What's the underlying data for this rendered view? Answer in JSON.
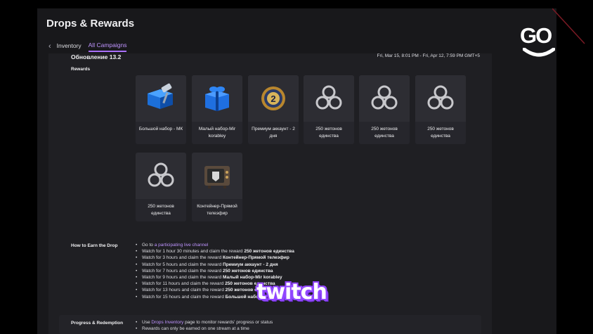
{
  "window": {
    "title": "Drops & Rewards"
  },
  "tabs": [
    {
      "label": "Inventory",
      "active": false
    },
    {
      "label": "All Campaigns",
      "active": true
    }
  ],
  "campaign": {
    "name": "Обновление 13.2",
    "dates": "Fri, Mar 15, 8:01 PM - Fri, Apr 12, 7:59 PM GMT+5"
  },
  "rewards_label": "Rewards",
  "rewards": [
    {
      "name": "Большой набор - МК",
      "icon": "blue-box-with-item-icon"
    },
    {
      "name": "Малый набор-Mir korabley",
      "icon": "blue-gift-box-icon"
    },
    {
      "name": "Премиум аккаунт - 2 дня",
      "icon": "premium-badge-icon"
    },
    {
      "name": "250 жетонов единства",
      "icon": "unity-token-icon"
    },
    {
      "name": "250 жетонов единства",
      "icon": "unity-token-icon"
    },
    {
      "name": "250 жетонов единства",
      "icon": "unity-token-icon"
    },
    {
      "name": "250 жетонов единства",
      "icon": "unity-token-icon"
    },
    {
      "name": "Контейнер-Прямой телеэфир",
      "icon": "tv-container-icon"
    }
  ],
  "how_to": {
    "label": "How to Earn the Drop",
    "go_to_prefix": "Go to ",
    "go_to_link": "a participating live channel",
    "steps": [
      {
        "text": "Watch for 1 hour 30 minutes and claim the reward ",
        "reward": "250 жетонов единства"
      },
      {
        "text": "Watch for 3 hours and claim the reward ",
        "reward": "Контейнер-Прямой телеэфир"
      },
      {
        "text": "Watch for 5 hours and claim the reward ",
        "reward": "Премиум аккаунт - 2 дня"
      },
      {
        "text": "Watch for 7 hours and claim the reward ",
        "reward": "250 жетонов единства"
      },
      {
        "text": "Watch for 9 hours and claim the reward ",
        "reward": "Малый набор-Mir korabley"
      },
      {
        "text": "Watch for 11 hours and claim the reward ",
        "reward": "250 жетонов единства"
      },
      {
        "text": "Watch for 13 hours and claim the reward ",
        "reward": "250 жетонов единства"
      },
      {
        "text": "Watch for 15 hours and claim the reward ",
        "reward": "Большой набор"
      }
    ]
  },
  "progress": {
    "label": "Progress & Redemption",
    "line1_prefix": "Use ",
    "line1_link": "Drops Inventory",
    "line1_suffix": " page to monitor rewards' progress or status",
    "line2": "Rewards can only be earned on one stream at a time"
  },
  "watermarks": {
    "go": "GO",
    "twitch": "twitch"
  },
  "colors": {
    "accent": "#a970ff",
    "twitch_purple": "#9146ff",
    "background": "#18181b"
  }
}
